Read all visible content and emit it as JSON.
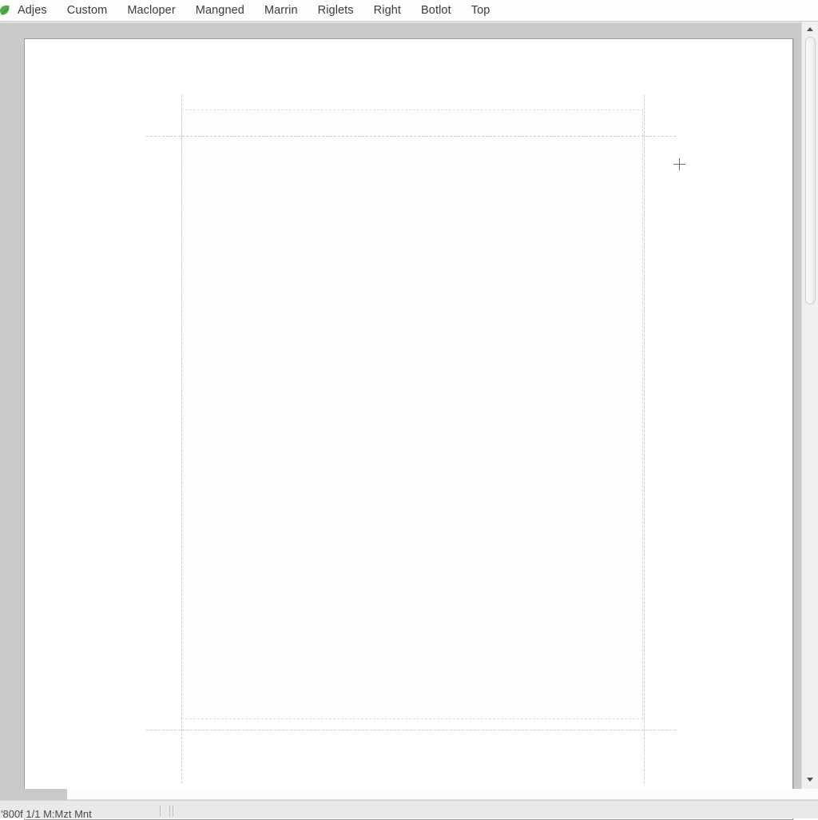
{
  "toolbar": {
    "leaf_icon_name": "leaf-icon",
    "leaf_icon_color": "#5aa84f",
    "items": [
      {
        "label": "Adjes"
      },
      {
        "label": "Custom"
      },
      {
        "label": "Macloper"
      },
      {
        "label": "Mangned"
      },
      {
        "label": "Marrin"
      },
      {
        "label": "Riglets"
      },
      {
        "label": "Right"
      },
      {
        "label": "Botlot"
      },
      {
        "label": "Top"
      }
    ]
  },
  "workspace": {
    "background_color": "#c9c9c9",
    "page": {
      "background_color": "#ffffff",
      "border_color": "#9b9b9b"
    },
    "guides": {
      "color": "#c4c4c4",
      "style": "dashed"
    },
    "cursor": {
      "name": "crosshair-plus-cursor",
      "color": "#6d6d6d"
    }
  },
  "scrollbar": {
    "up_arrow_glyph": "▲",
    "down_arrow_glyph": "▼",
    "track_color": "#f0f0f0",
    "thumb_color": "#f3f3f3"
  },
  "statusbar": {
    "text": "'800f  1/1 M:Mzt  Mnt",
    "background_color": "#e9e9e9"
  }
}
